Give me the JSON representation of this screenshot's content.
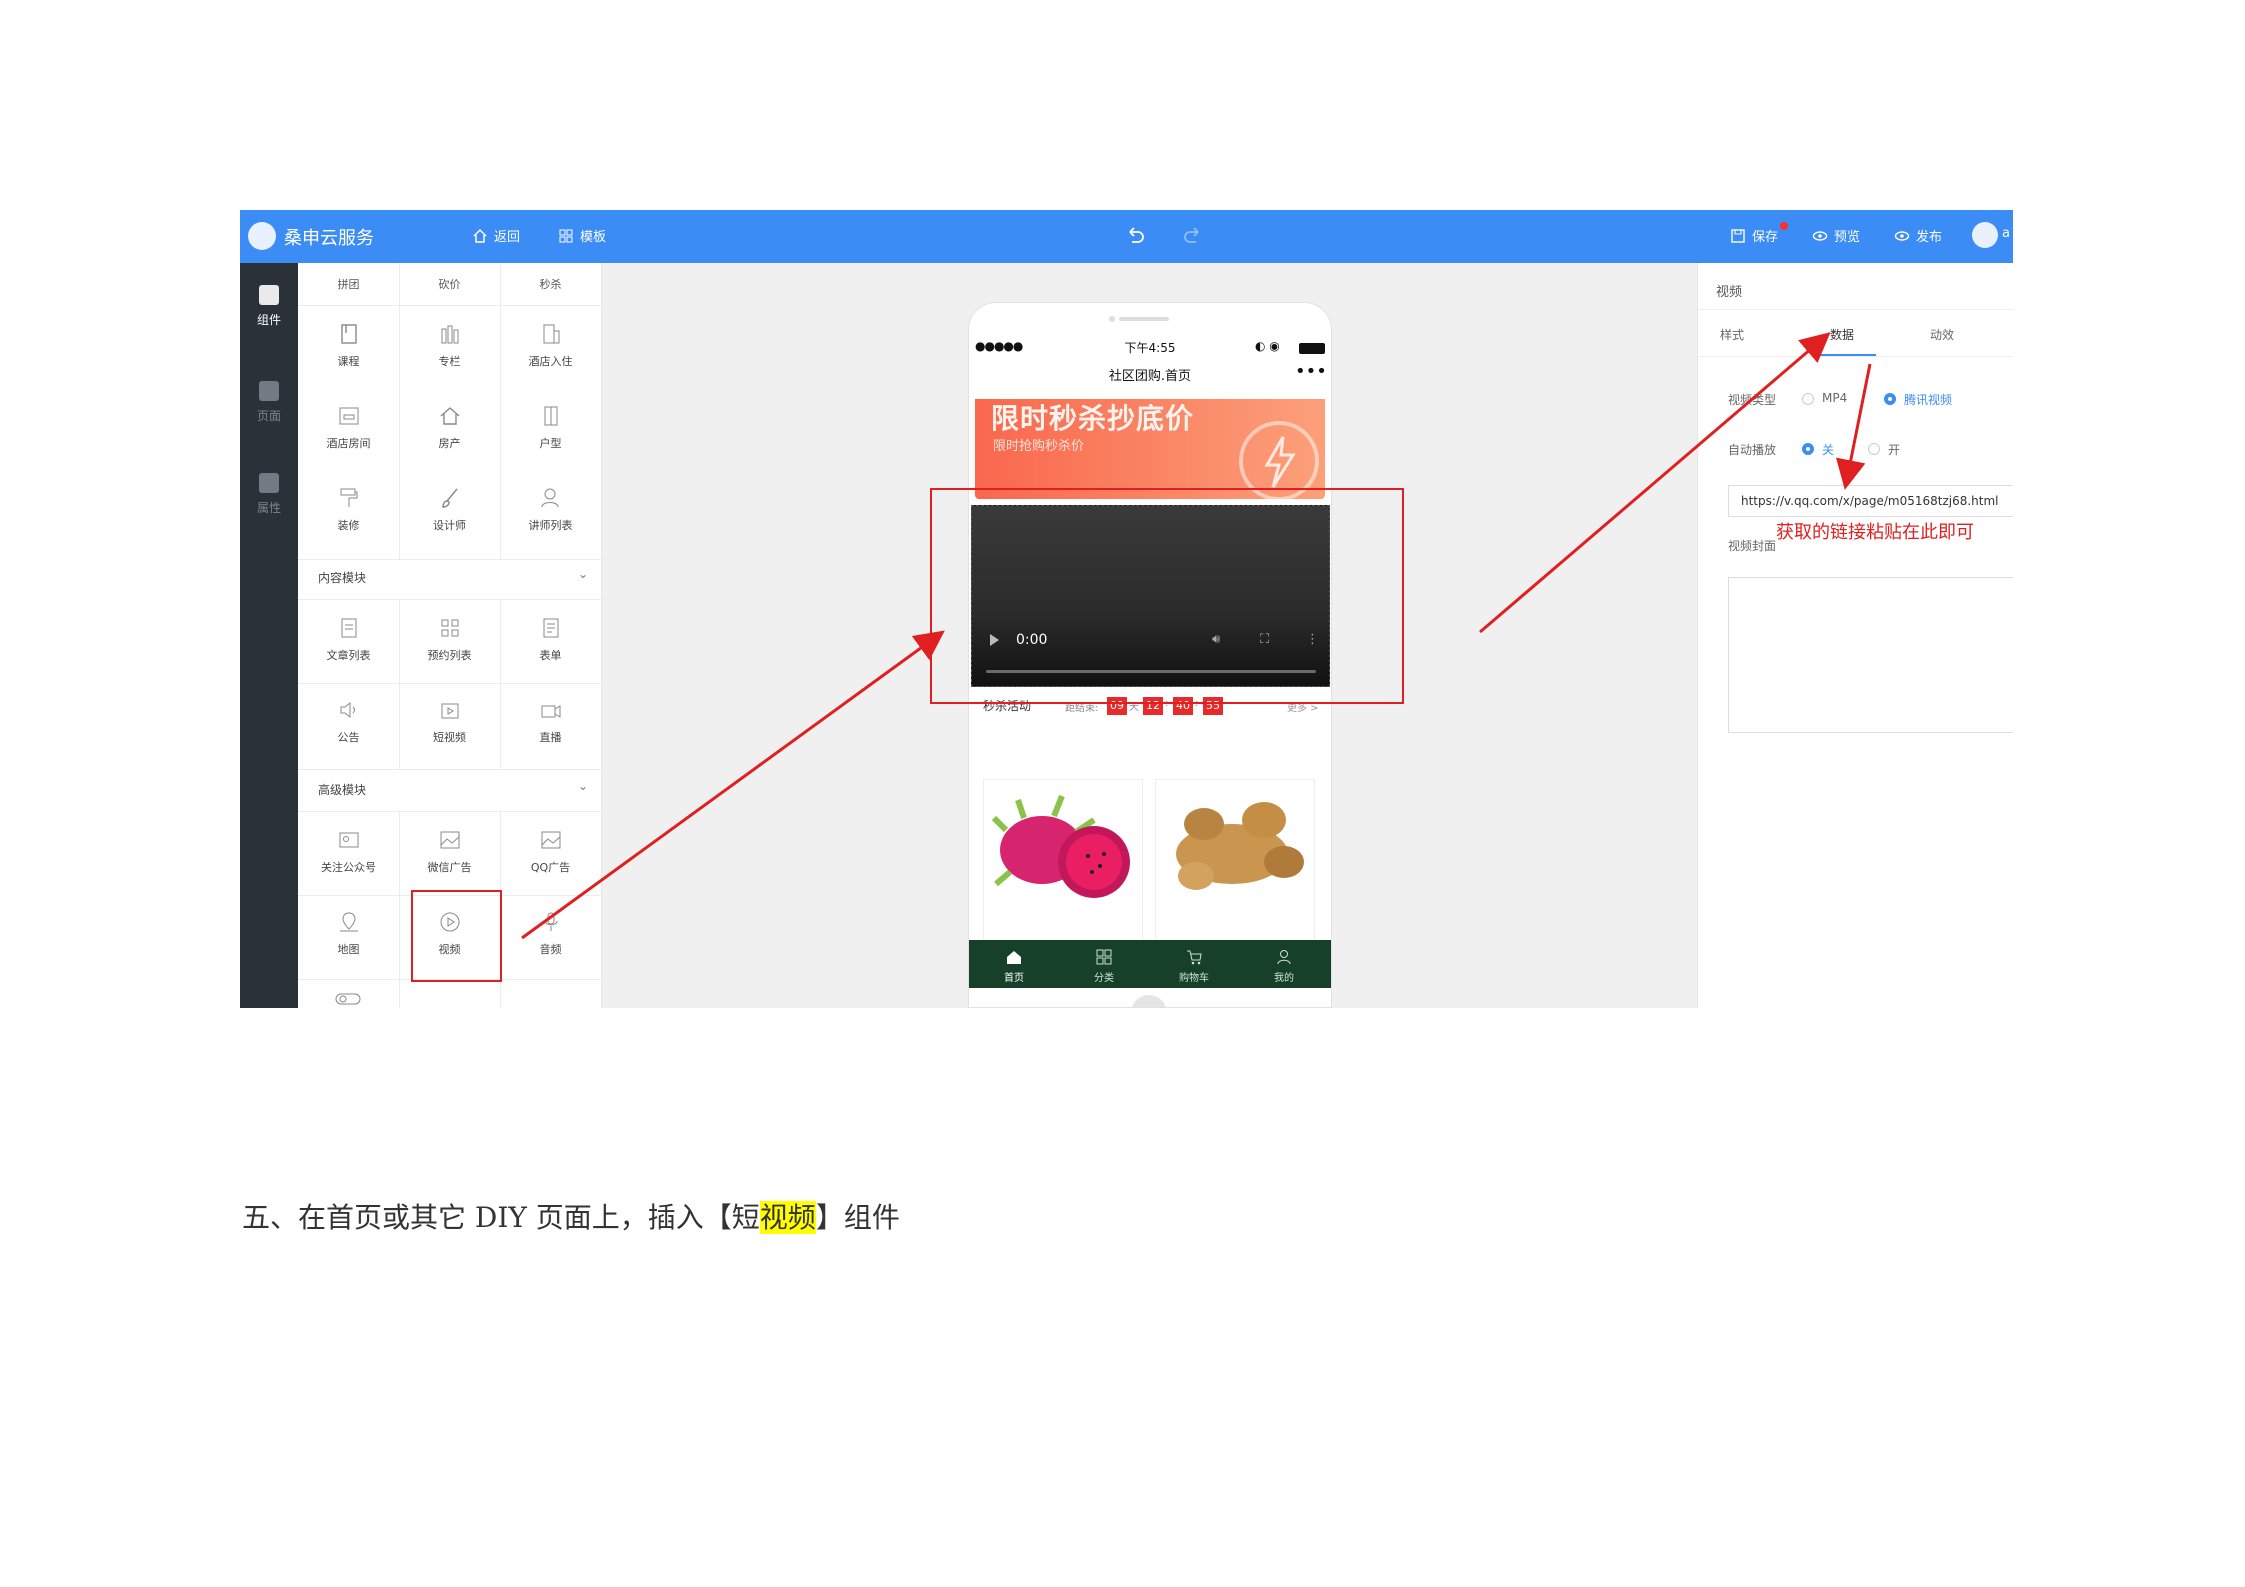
{
  "app": {
    "brand": "桑申云服务",
    "nav_back": "返回",
    "nav_template": "模板",
    "save": "保存",
    "preview": "预览",
    "publish": "发布",
    "user_initial": "a"
  },
  "rail": {
    "components": "组件",
    "pages": "页面",
    "properties": "属性"
  },
  "panel": {
    "top_row": [
      "拼团",
      "砍价",
      "秒杀"
    ],
    "rows1": [
      [
        "课程",
        "专栏",
        "酒店入住"
      ],
      [
        "酒店房间",
        "房产",
        "户型"
      ],
      [
        "装修",
        "设计师",
        "讲师列表"
      ]
    ],
    "content_section": "内容模块",
    "rows2": [
      [
        "文章列表",
        "预约列表",
        "表单"
      ],
      [
        "公告",
        "短视频",
        "直播"
      ]
    ],
    "advanced_section": "高级模块",
    "rows3": [
      [
        "关注公众号",
        "微信广告",
        "QQ广告"
      ],
      [
        "地图",
        "视频",
        "音频"
      ]
    ]
  },
  "phone": {
    "signal": "●●●●●",
    "time": "下午4:55",
    "page_title": "社区团购.首页",
    "menu": "•••",
    "banner_title": "限时秒杀抄底价",
    "banner_sub": "限时抢购秒杀价",
    "video_time": "0:00",
    "seckill_label": "秒杀活动",
    "seckill_end": "距结束:",
    "cd_days": "09",
    "cd_day_unit": "天",
    "cd_h": "12",
    "cd_m": "40",
    "cd_s": "55",
    "more": "更多 >",
    "tabs": [
      "首页",
      "分类",
      "购物车",
      "我的"
    ]
  },
  "props": {
    "title": "视频",
    "tab_style": "样式",
    "tab_data": "数据",
    "tab_anim": "动效",
    "video_type_label": "视频类型",
    "opt_mp4": "MP4",
    "opt_tencent": "腾讯视频",
    "autoplay_label": "自动播放",
    "opt_off": "关",
    "opt_on": "开",
    "url_value": "https://v.qq.com/x/page/m05168tzj68.html",
    "cover_label": "视频封面"
  },
  "annotation": {
    "note": "获取的链接粘贴在此即可"
  },
  "caption": {
    "before": "五、在首页或其它 DIY 页面上，插入【短",
    "highlight": "视频",
    "after": "】组件"
  },
  "colors": {
    "topbar": "#3b8cf5",
    "rail": "#2a3139",
    "annotation_red": "#e02020",
    "tabbar": "#17402a",
    "countdown": "#e82a2a",
    "highlight": "#ffff00"
  }
}
